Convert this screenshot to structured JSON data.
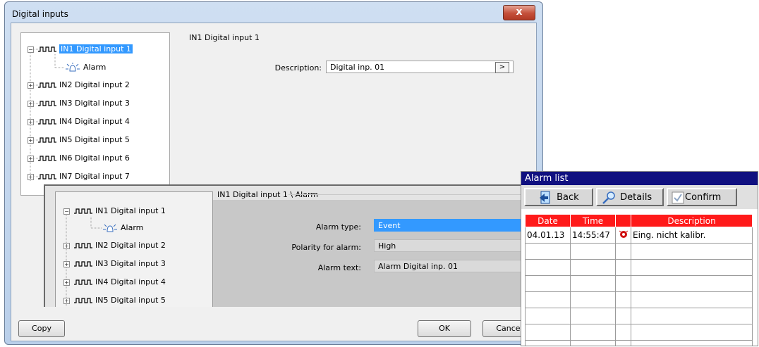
{
  "dialog": {
    "title": "Digital inputs",
    "close": "x",
    "tree": [
      {
        "label": "IN1 Digital input 1",
        "expander": "−",
        "selected": true
      },
      {
        "label": "Alarm",
        "child": true
      },
      {
        "label": "IN2 Digital input 2",
        "expander": "+"
      },
      {
        "label": "IN3 Digital input 3",
        "expander": "+"
      },
      {
        "label": "IN4 Digital input 4",
        "expander": "+"
      },
      {
        "label": "IN5 Digital input 5",
        "expander": "+"
      },
      {
        "label": "IN6 Digital input 6",
        "expander": "+"
      },
      {
        "label": "IN7 Digital input 7",
        "expander": "+"
      }
    ],
    "panel_title": "IN1 Digital input 1",
    "description_label": "Description:",
    "description_value": "Digital inp. 01",
    "description_btn": ">",
    "copy_button": "Copy",
    "ok_button": "OK",
    "cancel_button": "Cancel"
  },
  "overlay": {
    "tree": [
      {
        "label": "IN1 Digital input 1",
        "expander": "−"
      },
      {
        "label": "Alarm",
        "child": true
      },
      {
        "label": "IN2 Digital input 2",
        "expander": "+"
      },
      {
        "label": "IN3 Digital input 3",
        "expander": "+"
      },
      {
        "label": "IN4 Digital input 4",
        "expander": "+"
      },
      {
        "label": "IN5 Digital input 5",
        "expander": "+"
      }
    ],
    "panel_title": "IN1 Digital input 1 \\ Alarm",
    "alarm_type_label": "Alarm type:",
    "alarm_type_value": "Event",
    "polarity_label": "Polarity for alarm:",
    "polarity_value": "High",
    "alarm_text_label": "Alarm text:",
    "alarm_text_value": "Alarm Digital inp. 01"
  },
  "alarm_list": {
    "title": "Alarm list",
    "back": "Back",
    "details": "Details",
    "confirm": "Confirm",
    "headers": {
      "date": "Date",
      "time": "Time",
      "icon": "",
      "description": "Description"
    },
    "rows": [
      {
        "date": "04.01.13",
        "time": "14:55:47",
        "description": "Eing. nicht kalibr."
      },
      {
        "date": "",
        "time": "",
        "description": ""
      },
      {
        "date": "",
        "time": "",
        "description": ""
      },
      {
        "date": "",
        "time": "",
        "description": ""
      },
      {
        "date": "",
        "time": "",
        "description": ""
      },
      {
        "date": "",
        "time": "",
        "description": ""
      },
      {
        "date": "",
        "time": "",
        "description": ""
      },
      {
        "date": "",
        "time": "",
        "description": ""
      }
    ]
  },
  "colors": {
    "selection": "#3399ff",
    "alarm_header": "#ff1a1a",
    "alarm_title": "#101080"
  }
}
